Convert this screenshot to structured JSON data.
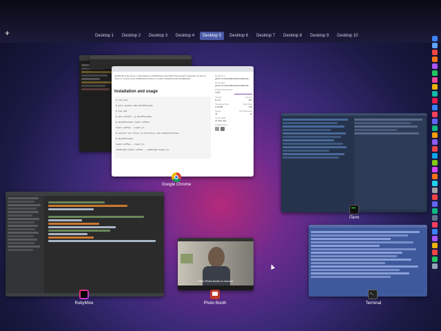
{
  "mission_control": {
    "add_desktop": "+",
    "desktops": [
      "Desktop 1",
      "Desktop 2",
      "Desktop 3",
      "Desktop 4",
      "Desktop 5",
      "Desktop 6",
      "Desktop 7",
      "Desktop 8",
      "Desktop 9",
      "Desktop 10"
    ],
    "active_desktop_index": 4
  },
  "chrome": {
    "label": "Google Chrome",
    "heading": "Installation and usage",
    "intro": "JavaScript is the future, in part thanks to CoffeeScript. Now that it has served its purpose, it's time to move on. Convert your CoffeeScript source to modern JavaScript with decaffeinate.",
    "code_lines": [
      "# via yarn",
      "$ yarn global add decaffeinate",
      "# via npm",
      "$ npm install -g decaffeinate",
      "$ decaffeinate input.coffee",
      "input.coffee → input.js",
      "# convert all files in directory and subdirectories",
      "$ decaffeinate",
      "input.coffee → input.js",
      "subfolder/input.coffee → subfolder/input.js"
    ],
    "sidebar": {
      "repository_label": "Repository",
      "repository": "github.com/decaffeinate/decaffeinate",
      "homepage_label": "Homepage",
      "homepage": "github.com/decaffeinate/decaffeinate",
      "weekly_downloads_label": "Weekly Downloads",
      "weekly_downloads": "7,004",
      "version_label": "Version",
      "version": "8.1.13",
      "license_label": "License",
      "license": "MIT",
      "unpacked_size_label": "Unpacked Size",
      "unpacked_size": "1.40 MB",
      "total_files_label": "Total Files",
      "total_files": "616",
      "issues_label": "Issues",
      "issues": "42",
      "pull_requests_label": "Pull Requests",
      "pull_requests": "15",
      "last_publish_label": "Last publish",
      "last_publish": "13 days ago",
      "collaborators_label": "Collaborators"
    }
  },
  "iterm": {
    "label": "iTerm"
  },
  "rubymine": {
    "label": "RubyMine"
  },
  "photo_booth": {
    "label": "Photo Booth",
    "hint": "Click Photo Booth to resume"
  },
  "terminal": {
    "label": "Terminal"
  },
  "colors": {
    "active_desktop": "#4a5aa8",
    "terminal_blue": "#3f5a9c",
    "iterm_bg": "#26334c",
    "ide_bg": "#2b2b2b"
  }
}
